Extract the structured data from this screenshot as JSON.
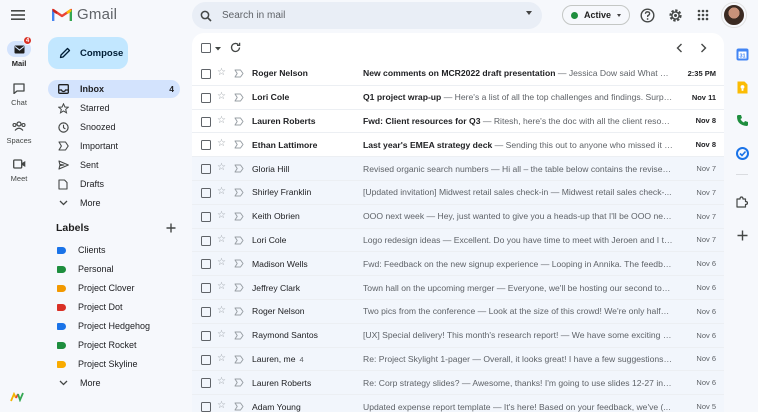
{
  "app": {
    "name": "Gmail"
  },
  "search": {
    "placeholder": "Search in mail"
  },
  "status": {
    "label": "Active",
    "color": "#1e8e3e"
  },
  "rail": {
    "items": [
      {
        "label": "Mail",
        "icon": "mail-icon",
        "badge": "4"
      },
      {
        "label": "Chat",
        "icon": "chat-icon"
      },
      {
        "label": "Spaces",
        "icon": "spaces-icon"
      },
      {
        "label": "Meet",
        "icon": "meet-icon"
      }
    ]
  },
  "compose": {
    "label": "Compose"
  },
  "nav": {
    "items": [
      {
        "label": "Inbox",
        "icon": "inbox-icon",
        "count": "4"
      },
      {
        "label": "Starred",
        "icon": "star-icon"
      },
      {
        "label": "Snoozed",
        "icon": "clock-icon"
      },
      {
        "label": "Important",
        "icon": "important-icon"
      },
      {
        "label": "Sent",
        "icon": "send-icon"
      },
      {
        "label": "Drafts",
        "icon": "draft-icon"
      },
      {
        "label": "More",
        "icon": "chevron-down-icon"
      }
    ]
  },
  "labels": {
    "title": "Labels",
    "items": [
      {
        "label": "Clients",
        "color": "#1a73e8"
      },
      {
        "label": "Personal",
        "color": "#1e8e3e"
      },
      {
        "label": "Project Clover",
        "color": "#f29900"
      },
      {
        "label": "Project Dot",
        "color": "#d93025"
      },
      {
        "label": "Project Hedgehog",
        "color": "#1a73e8"
      },
      {
        "label": "Project Rocket",
        "color": "#1e8e3e"
      },
      {
        "label": "Project Skyline",
        "color": "#f9ab00"
      }
    ],
    "more": "More"
  },
  "emails": [
    {
      "sender": "Roger Nelson",
      "count": "",
      "subject": "New comments on MCR2022 draft presentation",
      "snippet": " — Jessica Dow said What ab...",
      "date": "2:35 PM",
      "unread": true
    },
    {
      "sender": "Lori Cole",
      "count": "",
      "subject": "Q1 project wrap-up",
      "snippet": " — Here's a list of all the top challenges and findings. Surpri...",
      "date": "Nov 11",
      "unread": true
    },
    {
      "sender": "Lauren Roberts",
      "count": "",
      "subject": "Fwd: Client resources for Q3",
      "snippet": " — Ritesh, here's the doc with all the client resour...",
      "date": "Nov 8",
      "unread": true
    },
    {
      "sender": "Ethan Lattimore",
      "count": "",
      "subject": "Last year's EMEA strategy deck",
      "snippet": " — Sending this out to anyone who missed it R...",
      "date": "Nov 8",
      "unread": true
    },
    {
      "sender": "Gloria Hill",
      "count": "",
      "subject": "Revised organic search numbers",
      "snippet": " — Hi all – the table below contains the revised...",
      "date": "Nov 7",
      "unread": false
    },
    {
      "sender": "Shirley Franklin",
      "count": "",
      "subject": "[Updated invitation] Midwest retail sales check-in",
      "snippet": " — Midwest retail sales check-...",
      "date": "Nov 7",
      "unread": false
    },
    {
      "sender": "Keith Obrien",
      "count": "",
      "subject": "OOO next week",
      "snippet": " — Hey, just wanted to give you a heads-up that I'll be OOO next...",
      "date": "Nov 7",
      "unread": false
    },
    {
      "sender": "Lori Cole",
      "count": "",
      "subject": "Logo redesign ideas",
      "snippet": " — Excellent. Do you have time to meet with Jeroen and I thi...",
      "date": "Nov 7",
      "unread": false
    },
    {
      "sender": "Madison Wells",
      "count": "",
      "subject": "Fwd: Feedback on the new signup experience",
      "snippet": " — Looping in Annika. The feedbac...",
      "date": "Nov 6",
      "unread": false
    },
    {
      "sender": "Jeffrey Clark",
      "count": "",
      "subject": "Town hall on the upcoming merger",
      "snippet": " — Everyone, we'll be hosting our second tow...",
      "date": "Nov 6",
      "unread": false
    },
    {
      "sender": "Roger Nelson",
      "count": "",
      "subject": "Two pics from the conference",
      "snippet": " — Look at the size of this crowd! We're only halfw...",
      "date": "Nov 6",
      "unread": false
    },
    {
      "sender": "Raymond Santos",
      "count": "",
      "subject": "[UX] Special delivery! This month's research report!",
      "snippet": " — We have some exciting st...",
      "date": "Nov 6",
      "unread": false
    },
    {
      "sender": "Lauren, me",
      "count": "4",
      "subject": "Re: Project Skylight 1-pager",
      "snippet": " — Overall, it looks great! I have a few suggestions fo...",
      "date": "Nov 6",
      "unread": false
    },
    {
      "sender": "Lauren Roberts",
      "count": "",
      "subject": "Re: Corp strategy slides?",
      "snippet": " — Awesome, thanks! I'm going to use slides 12-27 in m...",
      "date": "Nov 6",
      "unread": false
    },
    {
      "sender": "Adam Young",
      "count": "",
      "subject": "Updated expense report template",
      "snippet": " — It's here! Based on your feedback, we've (...",
      "date": "Nov 5",
      "unread": false
    }
  ],
  "colors": {
    "accent": "#c2e7ff",
    "selected": "#d3e3fd",
    "background": "#f6f8fc"
  }
}
